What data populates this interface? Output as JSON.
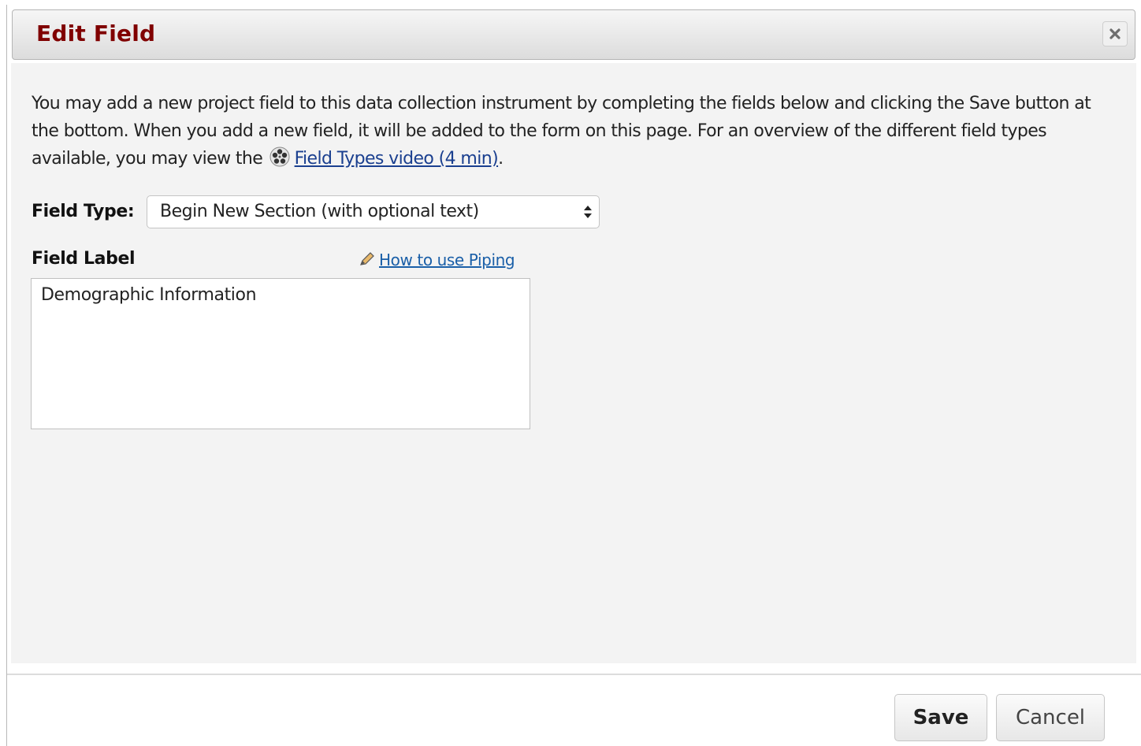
{
  "dialog": {
    "title": "Edit Field",
    "close_icon": "close-x-icon"
  },
  "intro": {
    "text": "You may add a new project field to this data collection instrument by completing the fields below and clicking the Save button at the bottom. When you add a new field, it will be added to the form on this page. For an overview of the different field types available, you may view the",
    "video_icon": "film-reel-icon",
    "video_link": "Field Types video (4 min)",
    "suffix": "."
  },
  "field_type": {
    "label": "Field Type:",
    "selected": "Begin New Section (with optional text)"
  },
  "field_label": {
    "label": "Field Label",
    "piping_icon": "pencil-icon",
    "piping_link": "How to use Piping",
    "value": "Demographic Information"
  },
  "footer": {
    "save_label": "Save",
    "cancel_label": "Cancel"
  },
  "colors": {
    "title": "#800000",
    "link": "#1a5fa8",
    "content_bg": "#f3f3f3"
  }
}
